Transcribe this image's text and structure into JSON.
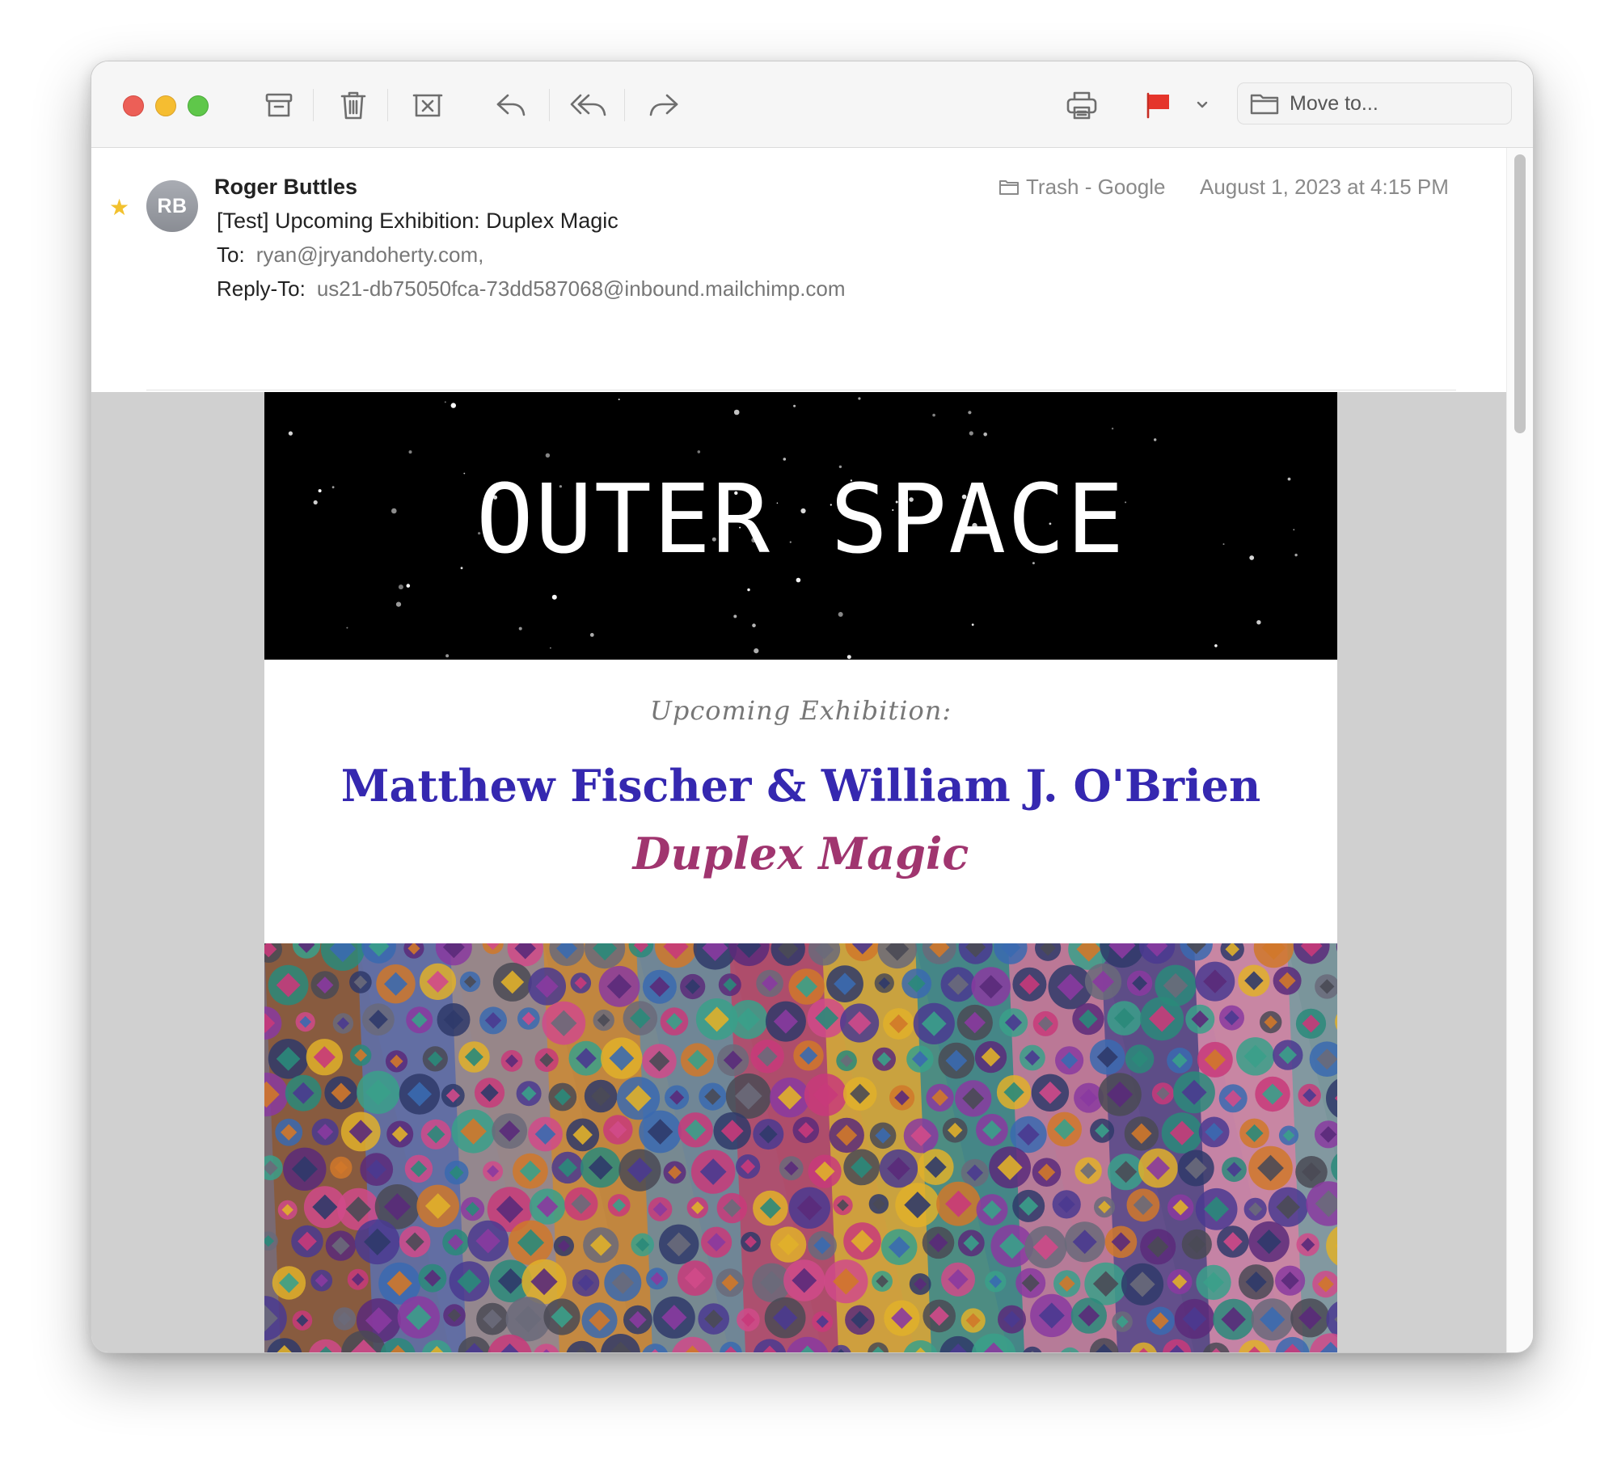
{
  "toolbar": {
    "buttons": [
      "archive",
      "trash",
      "junk",
      "reply",
      "reply-all",
      "forward",
      "print",
      "flag",
      "flag-menu"
    ],
    "flag_color": "#e5352b",
    "move_to_label": "Move to..."
  },
  "message": {
    "sender_initials": "RB",
    "sender_name": "Roger Buttles",
    "subject": "[Test] Upcoming Exhibition: Duplex Magic",
    "to_label": "To:",
    "to_value": "ryan@jryandoherty.com,",
    "reply_to_label": "Reply-To:",
    "reply_to_value": "us21-db75050fca-73dd587068@inbound.mailchimp.com",
    "mailbox": "Trash - Google",
    "date": "August 1, 2023 at 4:15 PM",
    "starred": true
  },
  "newsletter": {
    "banner_title": "OUTER SPACE",
    "intro": "Upcoming Exhibition:",
    "artists": "Matthew Fischer & William J. O'Brien",
    "show_title": "Duplex Magic"
  },
  "colors": {
    "artists_text": "#3528b0",
    "show_title_text": "#a0356f",
    "star": "#f2c12e"
  }
}
